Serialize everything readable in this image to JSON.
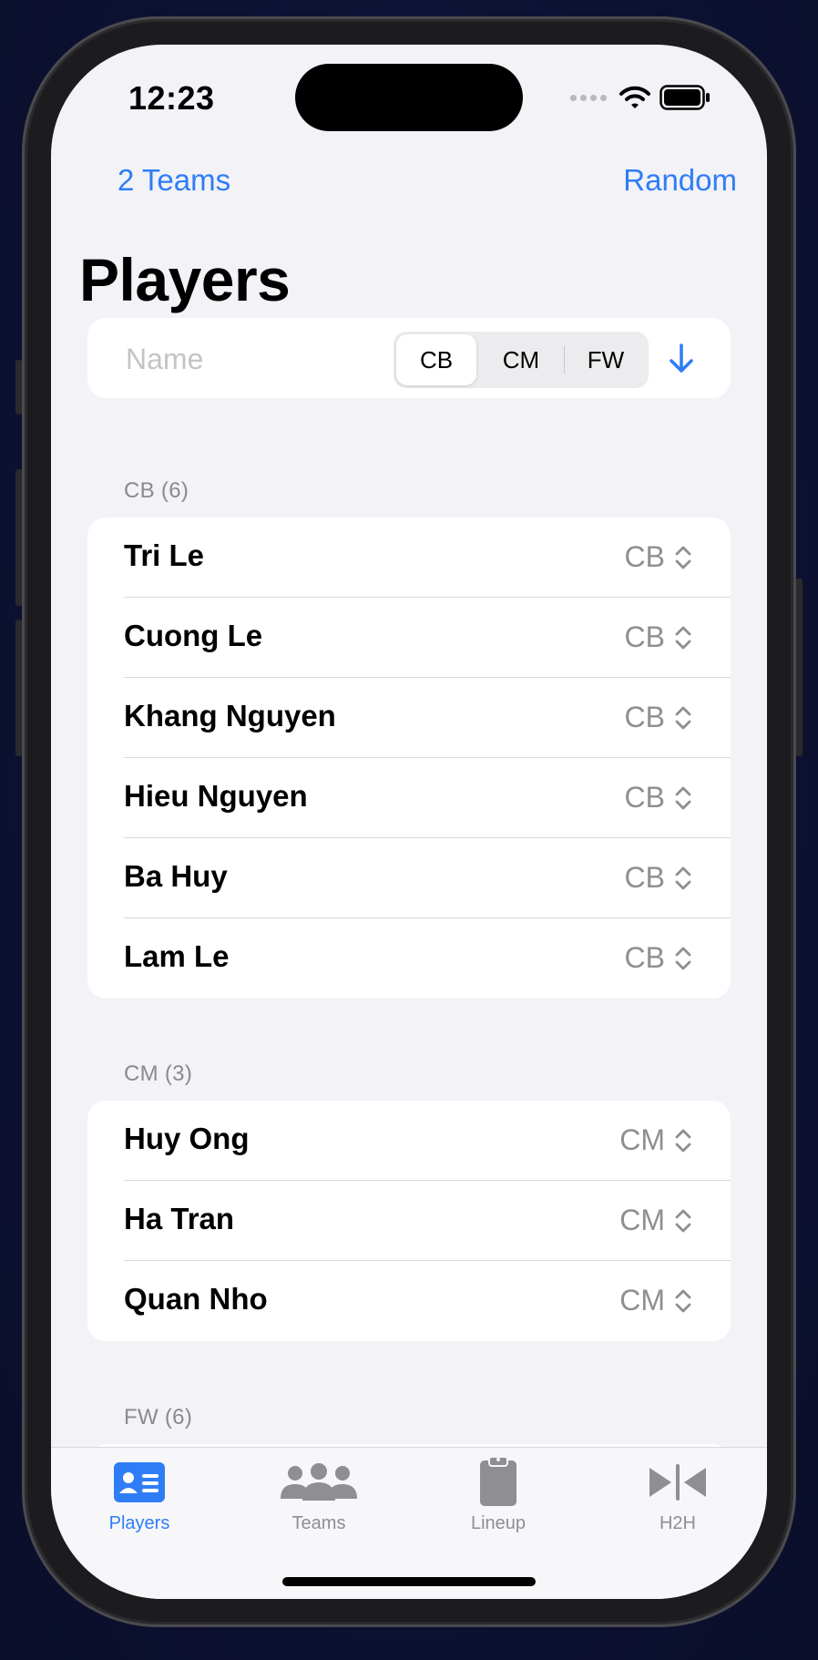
{
  "status_bar": {
    "time": "12:23"
  },
  "nav": {
    "left_label": "2 Teams",
    "right_label": "Random"
  },
  "title": "Players",
  "filter": {
    "name_placeholder": "Name",
    "segments": [
      "CB",
      "CM",
      "FW"
    ],
    "selected_segment": "CB",
    "sort_icon": "arrow-down-icon"
  },
  "sections": [
    {
      "header": "CB (6)",
      "players": [
        {
          "name": "Tri Le",
          "position": "CB"
        },
        {
          "name": "Cuong Le",
          "position": "CB"
        },
        {
          "name": "Khang Nguyen",
          "position": "CB"
        },
        {
          "name": "Hieu Nguyen",
          "position": "CB"
        },
        {
          "name": "Ba Huy",
          "position": "CB"
        },
        {
          "name": "Lam Le",
          "position": "CB"
        }
      ]
    },
    {
      "header": "CM (3)",
      "players": [
        {
          "name": "Huy Ong",
          "position": "CM"
        },
        {
          "name": "Ha Tran",
          "position": "CM"
        },
        {
          "name": "Quan Nho",
          "position": "CM"
        }
      ]
    },
    {
      "header": "FW (6)",
      "players": []
    }
  ],
  "tabbar": {
    "tabs": [
      {
        "label": "Players",
        "icon": "contact-card-icon",
        "active": true
      },
      {
        "label": "Teams",
        "icon": "people-group-icon",
        "active": false
      },
      {
        "label": "Lineup",
        "icon": "clipboard-icon",
        "active": false
      },
      {
        "label": "H2H",
        "icon": "head-to-head-icon",
        "active": false
      }
    ]
  },
  "colors": {
    "accent": "#2f7df6",
    "background": "#f2f2f7",
    "secondary_text": "#8e8e93"
  }
}
